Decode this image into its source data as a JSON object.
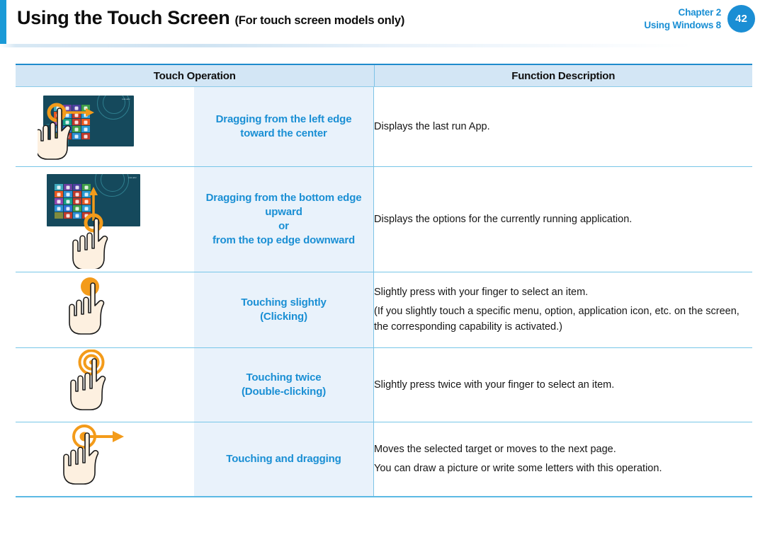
{
  "header": {
    "title": "Using the Touch Screen",
    "subtitle": "(For touch screen models only)",
    "chapter": "Chapter 2",
    "section": "Using Windows 8",
    "page_number": "42",
    "accent_color": "#1a9ad7",
    "badge_color": "#1b8ed4"
  },
  "table": {
    "columns": {
      "operation": "Touch Operation",
      "description": "Function Description"
    },
    "header_bg": "#d3e6f5",
    "label_bg": "#e9f2fb",
    "label_color": "#1a8fd4",
    "rows": [
      {
        "icon": "drag-from-left-edge-icon",
        "label": "Dragging from the left edge\ntoward the center",
        "description": [
          "Displays the last run App."
        ]
      },
      {
        "icon": "drag-from-bottom-edge-icon",
        "label": "Dragging from the bottom edge\nupward\nor\nfrom the top edge downward",
        "description": [
          "Displays the options for the currently running application."
        ]
      },
      {
        "icon": "single-tap-icon",
        "label": "Touching slightly\n(Clicking)",
        "description": [
          "Slightly press with your finger to select an item.",
          "(If you slightly touch a specific menu, option, application icon, etc. on the screen, the corresponding capability is activated.)"
        ]
      },
      {
        "icon": "double-tap-icon",
        "label": "Touching twice\n(Double-clicking)",
        "description": [
          "Slightly press twice with your finger to select an item."
        ]
      },
      {
        "icon": "tap-and-drag-icon",
        "label": "Touching and dragging",
        "description": [
          "Moves the selected target or moves to the next page.",
          "You can draw a picture or write some letters with this operation."
        ]
      }
    ]
  },
  "tile_colors": {
    "row1": [
      "#3fa9bd",
      "#6b3fa0",
      "#4a3f9e",
      "#3f9e47"
    ],
    "row2": [
      "#e8571f",
      "#2d8fd4",
      "#c0392b",
      "#2a9ad4"
    ],
    "row3": [
      "#8e44ad",
      "#16a085",
      "#c0392b",
      "#e8571f"
    ],
    "row4": [
      "#2d8fd4",
      "#2a6fd4",
      "#3f9e47",
      "#2a9ad4"
    ],
    "row5": [
      "#7f8c3f",
      "#c0392b",
      "#2d8fd4",
      "#c0392b"
    ]
  }
}
